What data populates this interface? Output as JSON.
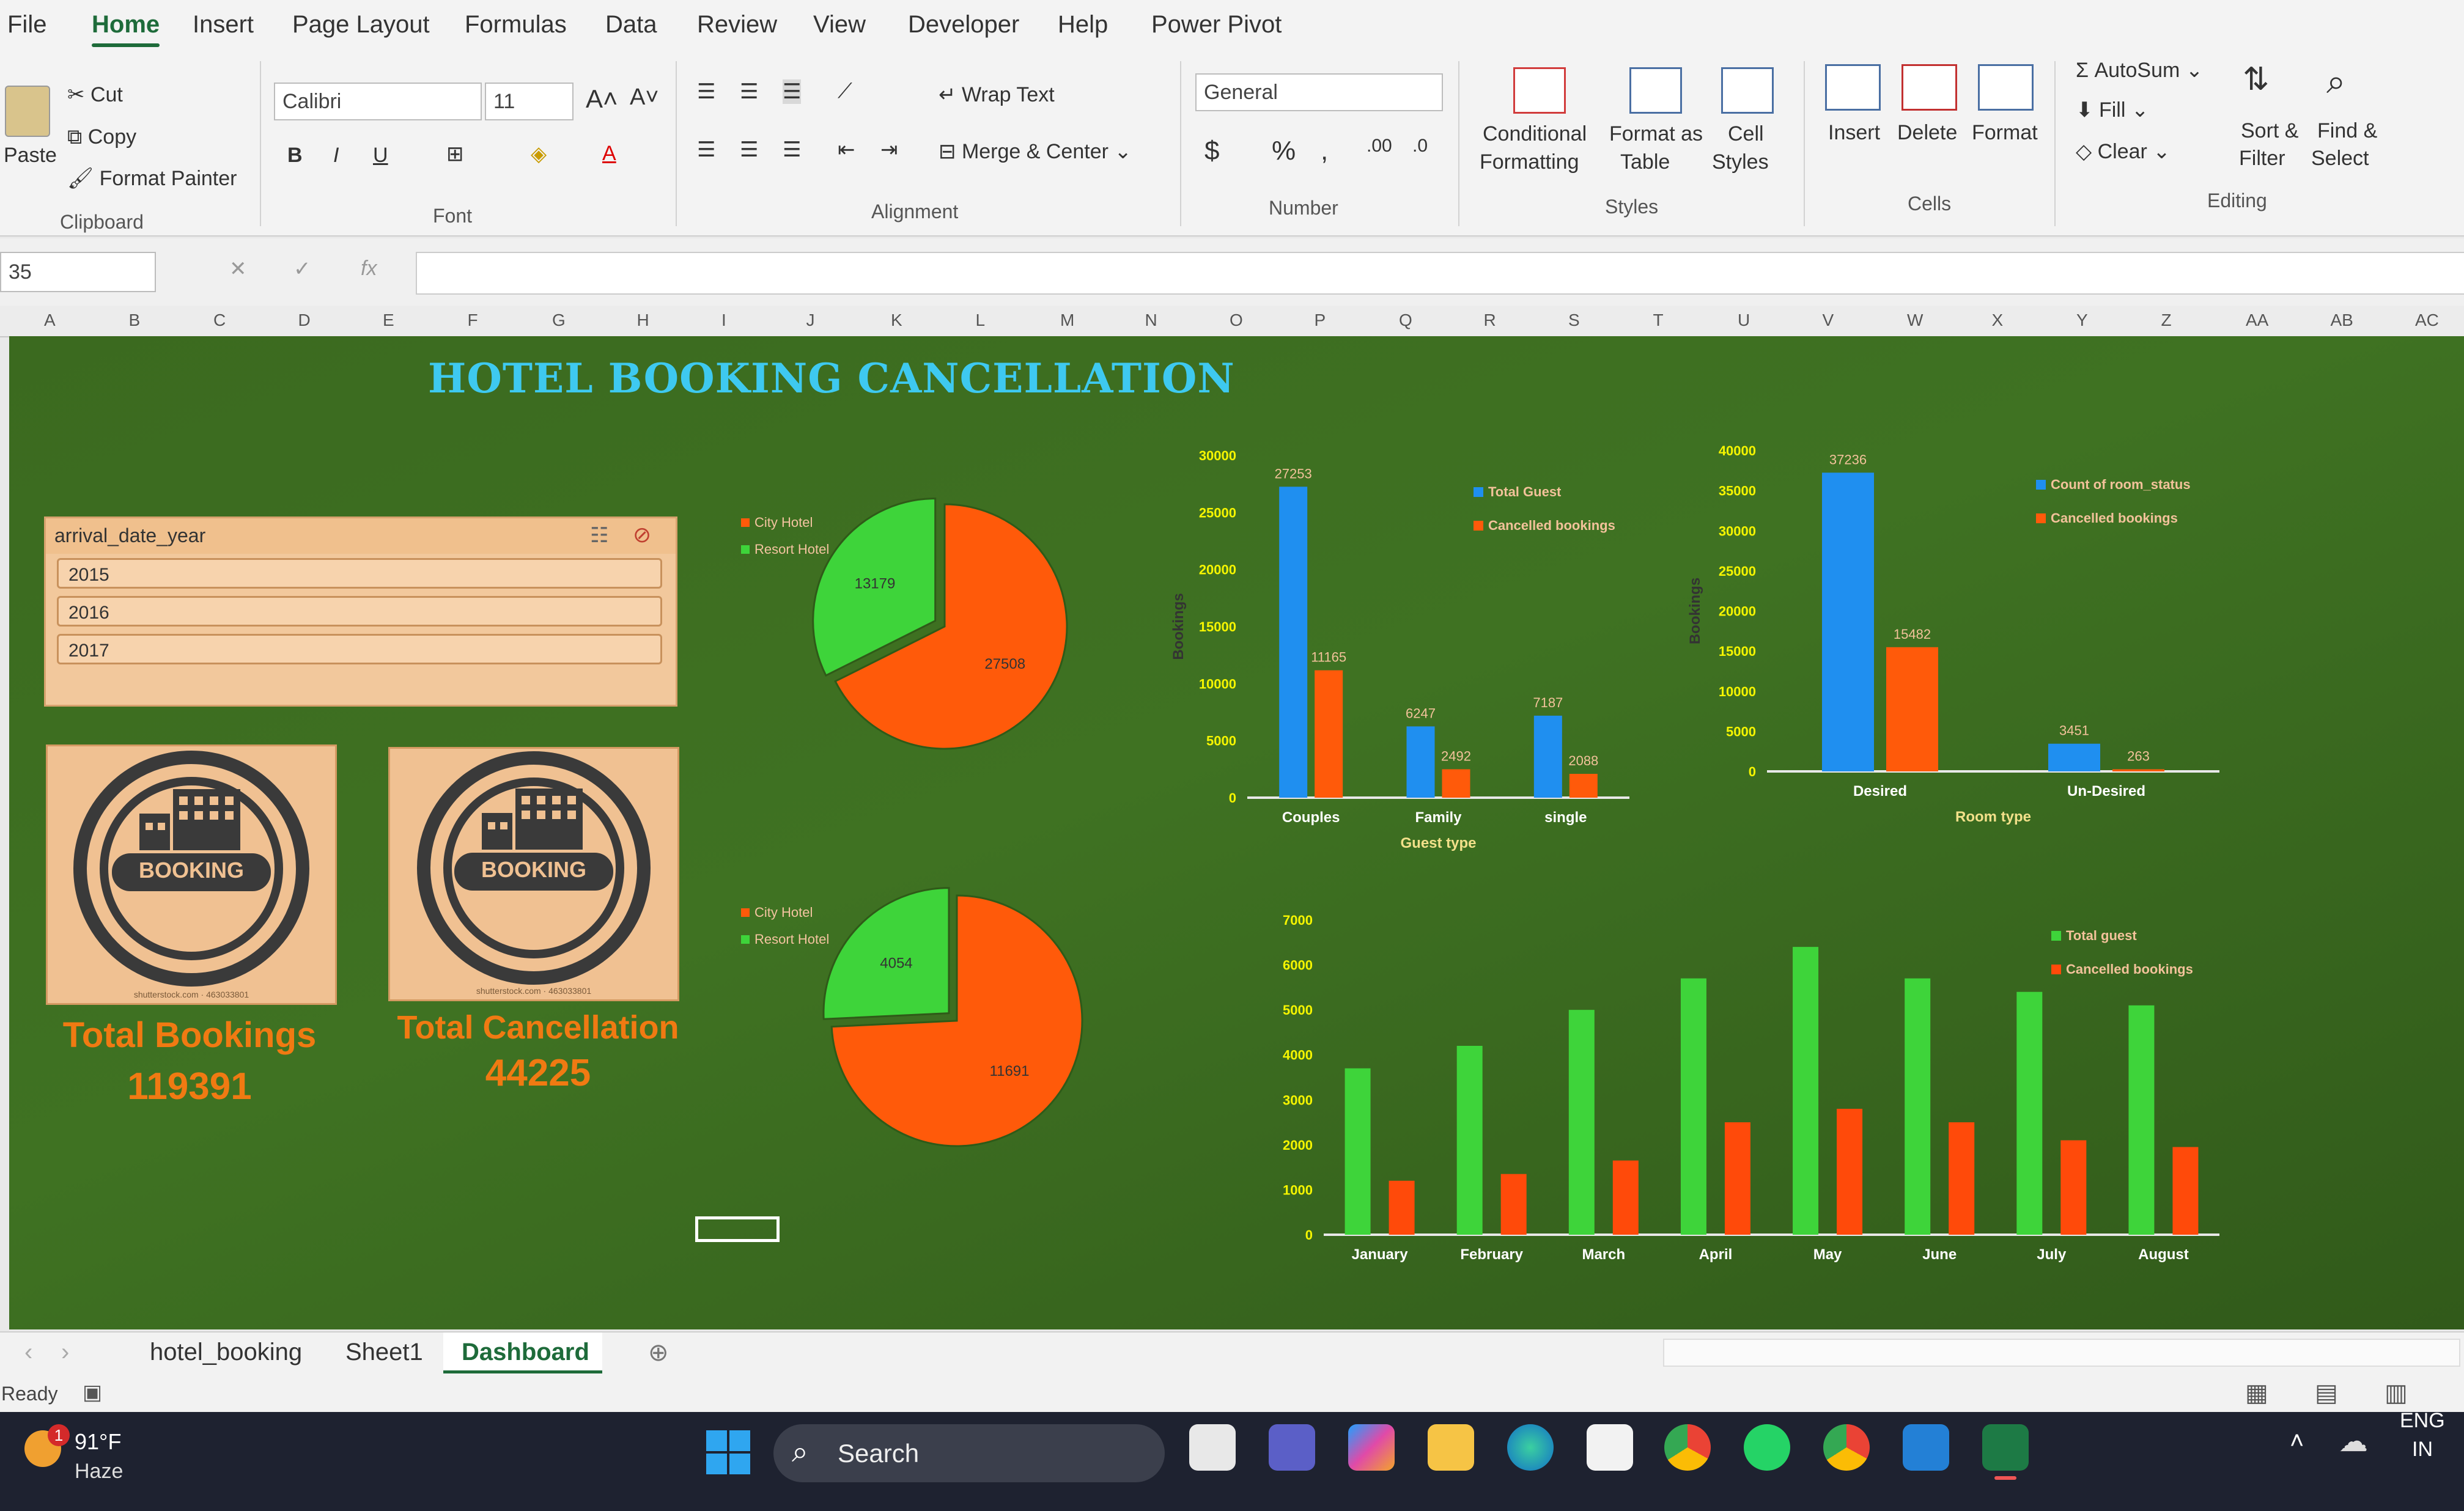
{
  "ribbon": {
    "tabs": [
      "File",
      "Home",
      "Insert",
      "Page Layout",
      "Formulas",
      "Data",
      "Review",
      "View",
      "Developer",
      "Help",
      "Power Pivot"
    ],
    "clipboard": {
      "paste": "Paste",
      "cut": "Cut",
      "copy": "Copy",
      "format_painter": "Format Painter",
      "label": "Clipboard"
    },
    "font": {
      "name": "Calibri",
      "size": "11",
      "label": "Font"
    },
    "alignment": {
      "wrap": "Wrap Text",
      "merge": "Merge & Center",
      "label": "Alignment"
    },
    "number": {
      "format": "General",
      "label": "Number"
    },
    "styles": {
      "conditional": "Conditional",
      "conditional2": "Formatting",
      "format_table": "Format as",
      "format_table2": "Table",
      "cell_styles": "Cell",
      "cell_styles2": "Styles",
      "label": "Styles"
    },
    "cells": {
      "insert": "Insert",
      "delete": "Delete",
      "format": "Format",
      "label": "Cells"
    },
    "editing": {
      "autosum": "AutoSum",
      "fill": "Fill",
      "clear": "Clear",
      "sort": "Sort &",
      "sort2": "Filter",
      "find": "Find &",
      "find2": "Select",
      "label": "Editing"
    }
  },
  "formula_bar": {
    "name_box": "35"
  },
  "columns": [
    "A",
    "B",
    "C",
    "D",
    "E",
    "F",
    "G",
    "H",
    "I",
    "J",
    "K",
    "L",
    "M",
    "N",
    "O",
    "P",
    "Q",
    "R",
    "S",
    "T",
    "U",
    "V",
    "W",
    "X",
    "Y",
    "Z",
    "AA",
    "AB",
    "AC"
  ],
  "dashboard": {
    "title": "HOTEL BOOKING CANCELLATION",
    "slicer": {
      "field": "arrival_date_year",
      "items": [
        "2015",
        "2016",
        "2017"
      ]
    },
    "badge_text": "BOOKING",
    "badge_credit": "shutterstock.com · 463033801",
    "kpi": [
      {
        "label": "Total Bookings",
        "value": "119391"
      },
      {
        "label": "Total Cancellation",
        "value": "44225"
      }
    ]
  },
  "chart_data": [
    {
      "type": "pie",
      "legend": [
        "City Hotel",
        "Resort Hotel"
      ],
      "values": [
        27508,
        13179
      ],
      "colors": [
        "#ff5a0a",
        "#3ed43a"
      ]
    },
    {
      "type": "pie",
      "legend": [
        "City Hotel",
        "Resort Hotel"
      ],
      "values": [
        11691,
        4054
      ],
      "colors": [
        "#ff5a0a",
        "#3ed43a"
      ]
    },
    {
      "type": "bar",
      "categories": [
        "Couples",
        "Family",
        "single"
      ],
      "series": [
        {
          "name": "Total Guest",
          "values": [
            27253,
            6247,
            7187
          ],
          "color": "#1f8ff0"
        },
        {
          "name": "Cancelled bookings",
          "values": [
            11165,
            2492,
            2088
          ],
          "color": "#ff5a0a"
        }
      ],
      "xlabel": "Guest type",
      "ylabel": "Bookings",
      "yticks": [
        0,
        5000,
        10000,
        15000,
        20000,
        25000,
        30000
      ],
      "ylim": [
        0,
        30000
      ]
    },
    {
      "type": "bar",
      "categories": [
        "Desired",
        "Un-Desired"
      ],
      "series": [
        {
          "name": "Count of room_status",
          "values": [
            37236,
            3451
          ],
          "color": "#1f8ff0"
        },
        {
          "name": "Cancelled bookings",
          "values": [
            15482,
            263
          ],
          "color": "#ff5a0a"
        }
      ],
      "xlabel": "Room type",
      "ylabel": "Bookings",
      "yticks": [
        0,
        5000,
        10000,
        15000,
        20000,
        25000,
        30000,
        35000,
        40000
      ],
      "ylim": [
        0,
        40000
      ]
    },
    {
      "type": "bar",
      "categories": [
        "January",
        "February",
        "March",
        "April",
        "May",
        "June",
        "July",
        "August"
      ],
      "series": [
        {
          "name": "Total guest",
          "values": [
            3700,
            4200,
            5000,
            5700,
            6400,
            5700,
            5400,
            5100
          ],
          "color": "#3ed43a"
        },
        {
          "name": "Cancelled bookings",
          "values": [
            1200,
            1350,
            1650,
            2500,
            2800,
            2500,
            2100,
            1950
          ],
          "color": "#ff4a0a"
        }
      ],
      "yticks": [
        0,
        1000,
        2000,
        3000,
        4000,
        5000,
        6000,
        7000
      ],
      "ylim": [
        0,
        7000
      ]
    }
  ],
  "sheets": {
    "tabs": [
      "hotel_booking",
      "Sheet1",
      "Dashboard"
    ],
    "active": "Dashboard"
  },
  "status": {
    "ready": "Ready"
  },
  "taskbar": {
    "temp": "91°F",
    "weather": "Haze",
    "search": "Search",
    "lang1": "ENG",
    "lang2": "IN",
    "notif": "1"
  }
}
